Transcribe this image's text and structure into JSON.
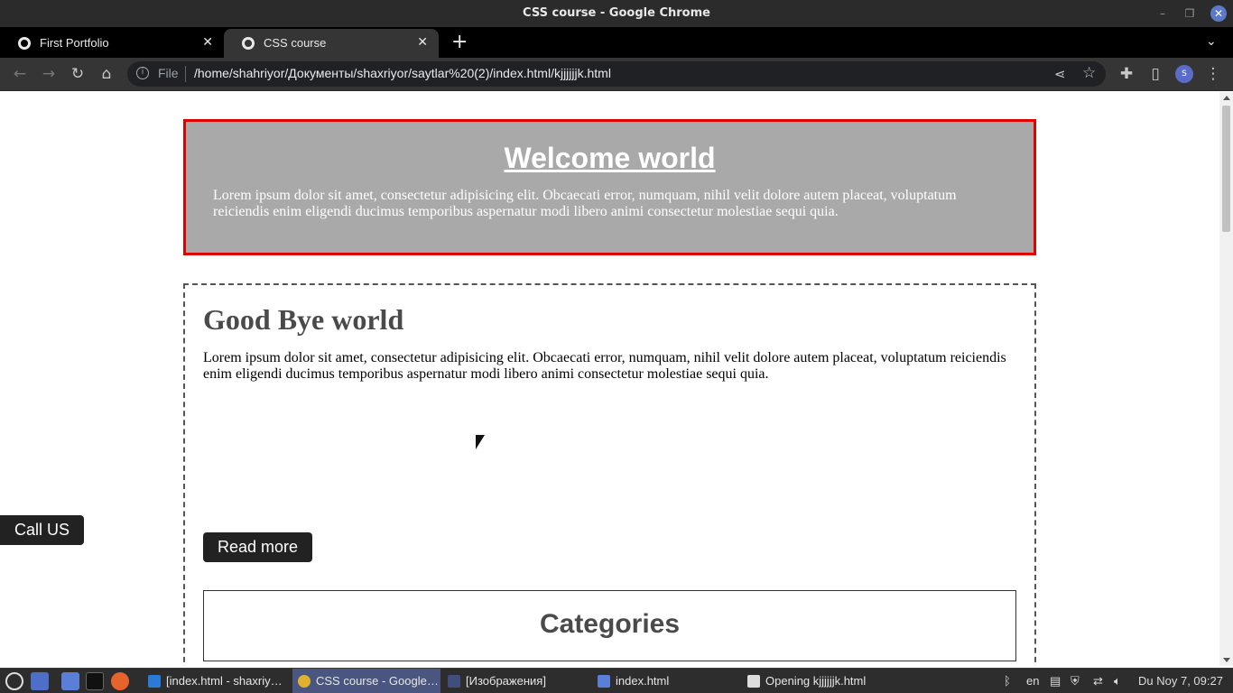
{
  "window": {
    "title": "CSS course - Google Chrome"
  },
  "tabs": [
    {
      "label": "First Portfolio",
      "active": false
    },
    {
      "label": "CSS course",
      "active": true
    }
  ],
  "toolbar": {
    "scheme_label": "File",
    "url": "/home/shahriyor/Документы/shaxriyor/saytlar%20(2)/index.html/kjjjjjjk.html",
    "profile_initial": "S"
  },
  "page": {
    "welcome": {
      "heading": "Welcome world",
      "text": "Lorem ipsum dolor sit amet, consectetur adipisicing elit. Obcaecati error, numquam, nihil velit dolore autem placeat, voluptatum reiciendis enim eligendi ducimus temporibus aspernatur modi libero animi consectetur molestiae sequi quia."
    },
    "goodbye": {
      "heading": "Good Bye world",
      "text": "Lorem ipsum dolor sit amet, consectetur adipisicing elit. Obcaecati error, numquam, nihil velit dolore autem placeat, voluptatum reiciendis enim eligendi ducimus temporibus aspernatur modi libero animi consectetur molestiae sequi quia.",
      "read_more_label": "Read more"
    },
    "categories_heading": "Categories",
    "call_us_label": "Call US"
  },
  "taskbar": {
    "tasks": [
      {
        "label": "[index.html - shaxriy…",
        "active": false
      },
      {
        "label": "CSS course - Google…",
        "active": true
      },
      {
        "label": "[Изображения]",
        "active": false
      },
      {
        "label": "index.html",
        "active": false
      },
      {
        "label": "Opening kjjjjjjk.html",
        "active": false
      }
    ],
    "keyboard_layout": "en",
    "clock": "Du Noy  7, 09:27"
  },
  "colors": {
    "welcome_bg": "#a9a9a9",
    "welcome_border": "#e00000",
    "button_bg": "#222222",
    "active_task": "#4a5580"
  }
}
